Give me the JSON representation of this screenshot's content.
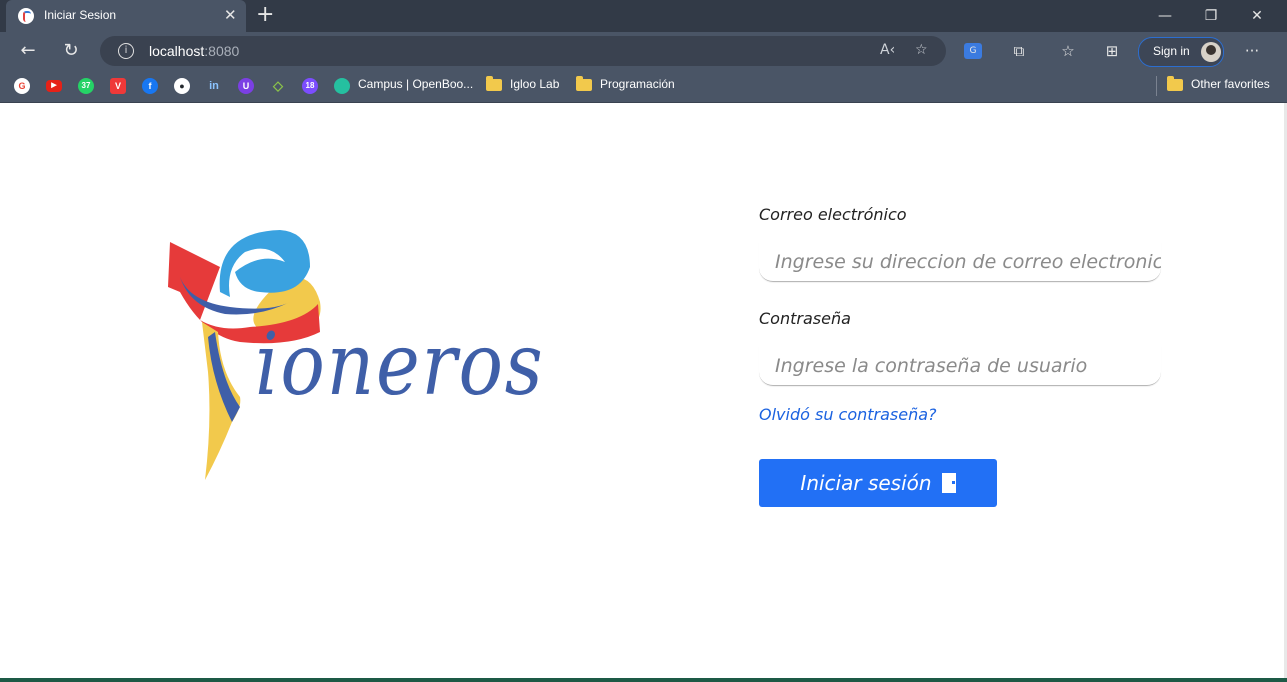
{
  "browser": {
    "tab_title": "Iniciar Sesion",
    "url_host": "localhost",
    "url_port": ":8080",
    "sign_in_label": "Sign in",
    "bookmarks": [
      {
        "label": "",
        "icon": "google-icon",
        "color": "#ea4335"
      },
      {
        "label": "",
        "icon": "youtube-icon",
        "color": "#e62117"
      },
      {
        "label": "",
        "icon": "whatsapp-icon",
        "color": "#25d366",
        "badge": "37"
      },
      {
        "label": "",
        "icon": "vivaldi-icon",
        "color": "#ef3939"
      },
      {
        "label": "",
        "icon": "facebook-icon",
        "color": "#1877f2"
      },
      {
        "label": "",
        "icon": "github-icon",
        "color": "#24292e"
      },
      {
        "label": "",
        "icon": "linkedin-icon",
        "color": "#0a66c2",
        "text": "in"
      },
      {
        "label": "",
        "icon": "ublock-icon",
        "color": "#7b3fe4"
      },
      {
        "label": "",
        "icon": "code-icon",
        "color": "#8bc34a"
      },
      {
        "label": "",
        "icon": "notification-icon",
        "color": "#7c4dff",
        "badge": "18"
      },
      {
        "label": "Campus | OpenBoo...",
        "icon": "campus-icon"
      },
      {
        "label": "Igloo Lab",
        "icon": "folder-icon"
      },
      {
        "label": "Programación",
        "icon": "folder-icon"
      }
    ],
    "other_favorites": "Other favorites"
  },
  "logo": {
    "wordmark": "ioneros"
  },
  "form": {
    "email_label": "Correo electrónico",
    "email_placeholder": "Ingrese su direccion de correo electronico",
    "password_label": "Contraseña",
    "password_placeholder": "Ingrese la contraseña de usuario",
    "forgot_link": "Olvidó su contraseña?",
    "submit_label": "Iniciar sesión"
  },
  "colors": {
    "accent": "#2270f5",
    "link": "#1b62e0",
    "logo_blue": "#3f5fa8",
    "logo_red": "#e63a3a",
    "logo_yellow": "#f2c94c",
    "logo_light_blue": "#3aa2e0"
  }
}
